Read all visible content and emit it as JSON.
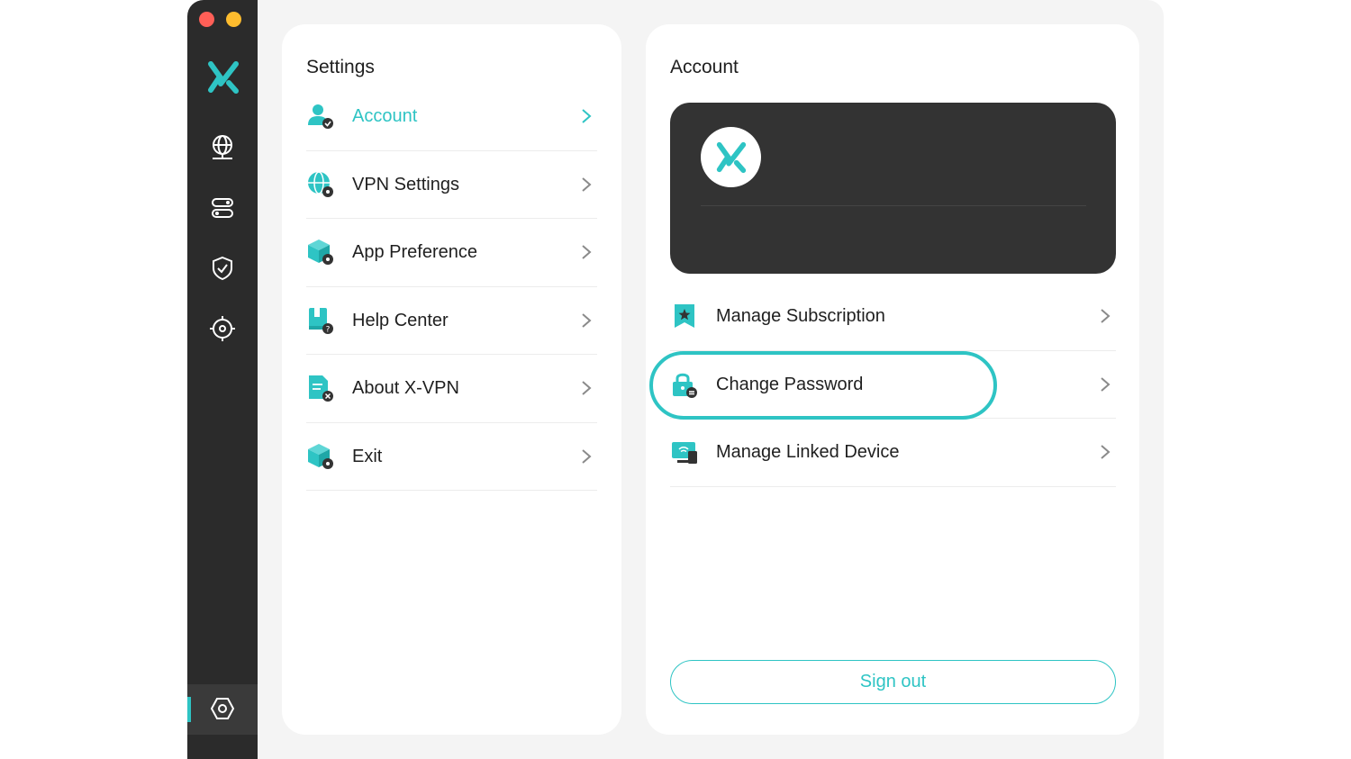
{
  "window": {
    "controls": [
      "close",
      "minimize"
    ]
  },
  "sidebar": {
    "logo": "x-vpn-logo",
    "items": [
      {
        "icon": "globe-icon"
      },
      {
        "icon": "server-icon"
      },
      {
        "icon": "shield-check-icon"
      },
      {
        "icon": "target-icon"
      },
      {
        "icon": "settings-hex-icon",
        "active": true
      }
    ]
  },
  "settings": {
    "title": "Settings",
    "items": [
      {
        "label": "Account",
        "icon": "user-check-icon",
        "active": true
      },
      {
        "label": "VPN Settings",
        "icon": "globe-gear-icon"
      },
      {
        "label": "App Preference",
        "icon": "cube-gear-icon"
      },
      {
        "label": "Help Center",
        "icon": "book-question-icon"
      },
      {
        "label": "About X-VPN",
        "icon": "document-x-icon"
      },
      {
        "label": "Exit",
        "icon": "cube-gear-icon"
      }
    ]
  },
  "account": {
    "title": "Account",
    "items": [
      {
        "label": "Manage Subscription",
        "icon": "bookmark-star-icon"
      },
      {
        "label": "Change Password",
        "icon": "lock-refresh-icon",
        "highlighted": true
      },
      {
        "label": "Manage Linked Device",
        "icon": "monitor-wifi-icon"
      }
    ],
    "sign_out_label": "Sign out"
  },
  "colors": {
    "accent": "#2ec4c4",
    "sidebar": "#2b2b2b",
    "card": "#333333"
  }
}
